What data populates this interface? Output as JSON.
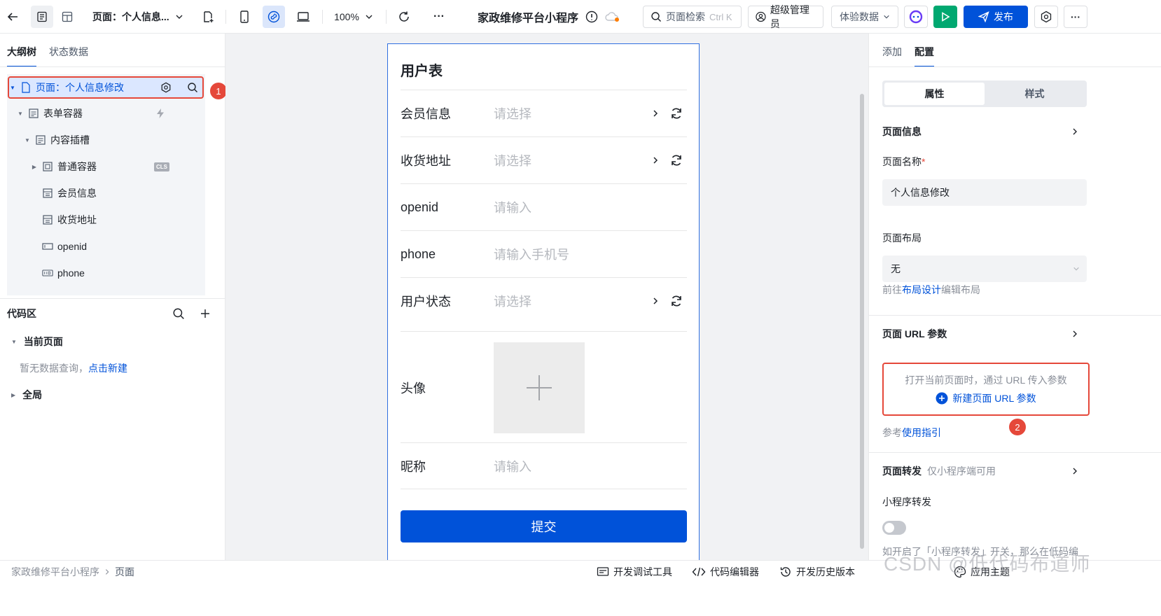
{
  "toolbar": {
    "page_select": "页面：个人信息...",
    "zoom": "100%",
    "app_title": "家政维修平台小程序",
    "search_placeholder": "页面检索",
    "search_shortcut": "Ctrl K",
    "admin_label": "超级管理员",
    "data_env": "体验数据",
    "publish_label": "发布",
    "more_label": "···"
  },
  "left": {
    "tabs": [
      "大纲树",
      "状态数据"
    ],
    "tree": [
      {
        "label": "页面：个人信息修改"
      },
      {
        "label": "表单容器"
      },
      {
        "label": "内容插槽"
      },
      {
        "label": "普通容器",
        "tag": "CLS"
      },
      {
        "label": "会员信息"
      },
      {
        "label": "收货地址"
      },
      {
        "label": "openid"
      },
      {
        "label": "phone"
      }
    ],
    "annotation_1": "1",
    "code": {
      "title": "代码区",
      "current_page": "当前页面",
      "empty_text": "暂无数据查询，",
      "create_link": "点击新建",
      "global": "全局"
    }
  },
  "form": {
    "title": "用户表",
    "rows": [
      {
        "label": "会员信息",
        "placeholder": "请选择"
      },
      {
        "label": "收货地址",
        "placeholder": "请选择"
      },
      {
        "label": "openid",
        "placeholder": "请输入"
      },
      {
        "label": "phone",
        "placeholder": "请输入手机号"
      },
      {
        "label": "用户状态",
        "placeholder": "请选择"
      },
      {
        "label": "头像"
      },
      {
        "label": "昵称",
        "placeholder": "请输入"
      }
    ],
    "submit_label": "提交"
  },
  "right": {
    "tabs": [
      "添加",
      "配置"
    ],
    "segment": [
      "属性",
      "样式"
    ],
    "page_info_title": "页面信息",
    "page_name_label": "页面名称",
    "required_mark": "*",
    "page_name_value": "个人信息修改",
    "layout_label": "页面布局",
    "layout_value": "无",
    "layout_link_prefix": "前往",
    "layout_link": "布局设计",
    "layout_link_suffix": "编辑布局",
    "url_title": "页面 URL 参数",
    "url_hint": "打开当前页面时，通过 URL 传入参数",
    "url_new": "新建页面 URL 参数",
    "annotation_2": "2",
    "guide_prefix": "参考",
    "guide_link": "使用指引",
    "forward_title": "页面转发",
    "forward_hint": "仅小程序端可用",
    "mini_forward_label": "小程序转发",
    "forward_note": "如开启了「小程序转发」开关，那么在低码编"
  },
  "statusbar": {
    "crumb_app": "家政维修平台小程序",
    "crumb_page": "页面",
    "debug": "开发调试工具",
    "code_editor": "代码编辑器",
    "history": "开发历史版本",
    "theme": "应用主题"
  },
  "watermark": "CSDN @低代码布道师",
  "colors": {
    "primary": "#0052d9",
    "run": "#00a870",
    "annotation": "#e5483a"
  }
}
